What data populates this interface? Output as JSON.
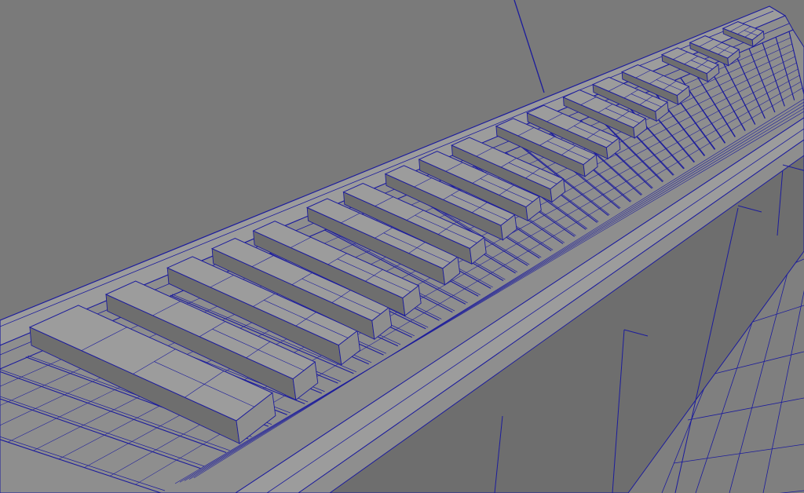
{
  "viewport": {
    "shading_mode": "wireframe-on-shaded",
    "colors": {
      "background": "#7a7a7a",
      "surface": "#8e8e8e",
      "surface_light": "#9c9c9c",
      "surface_dark": "#6e6e6e",
      "wire": "#1c1c9c"
    }
  },
  "piano": {
    "visible_black_keys": 18,
    "visible_white_key_edges": 48
  }
}
